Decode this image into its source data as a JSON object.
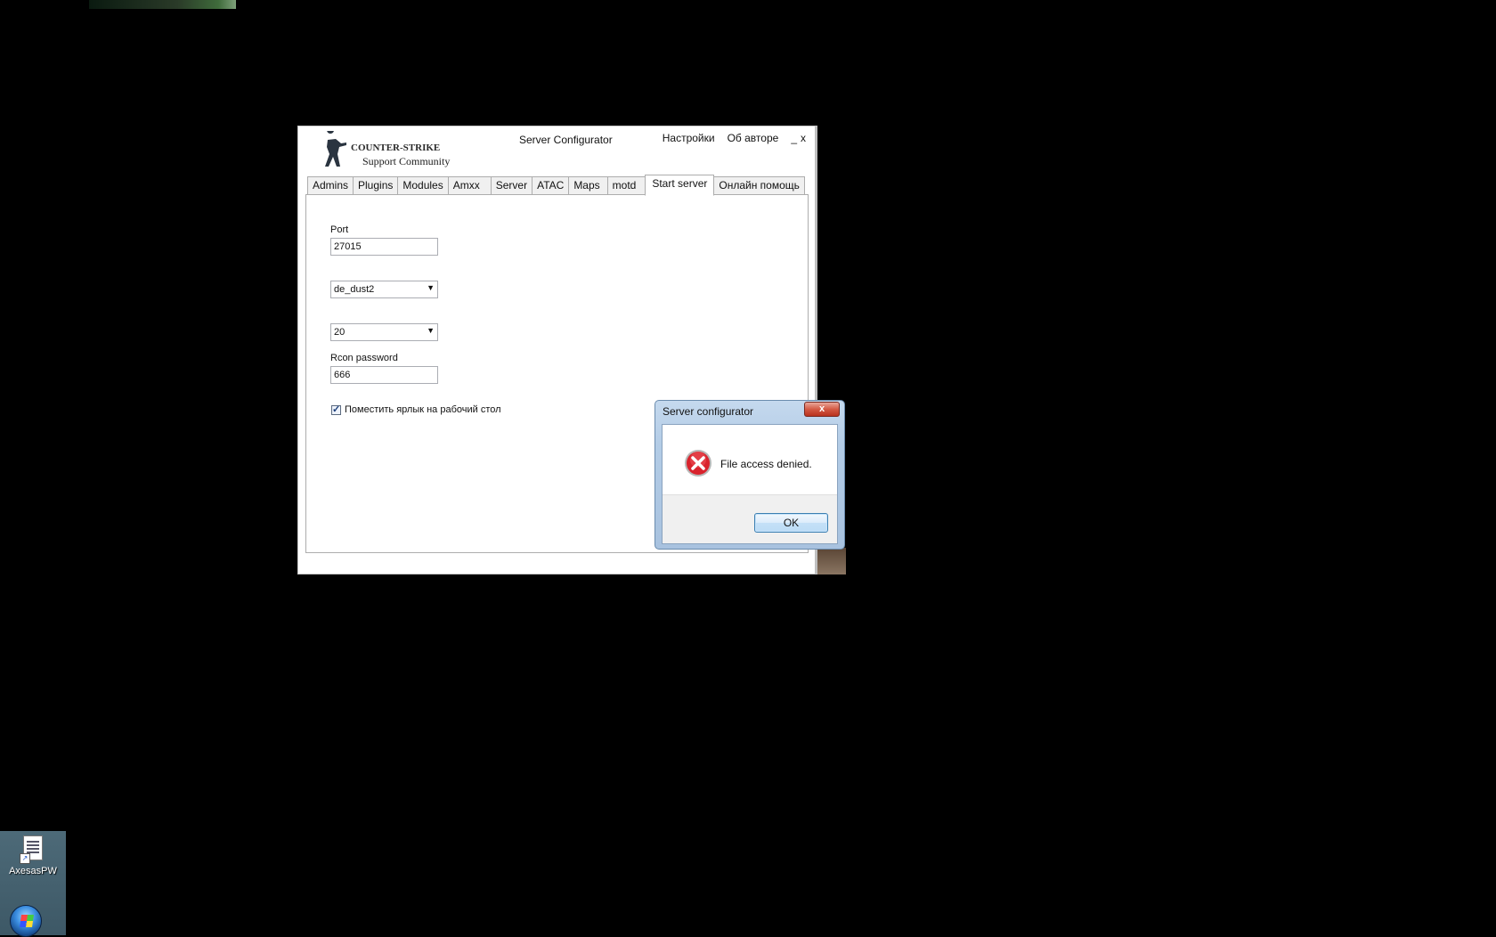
{
  "app": {
    "logo_line1": "COUNTER-STRIKE",
    "logo_line2": "Support Community",
    "title": "Server Configurator",
    "menu": {
      "settings": "Настройки",
      "about": "Об авторе",
      "minimize": "_",
      "close": "x"
    },
    "tabs": [
      {
        "label": "Admins"
      },
      {
        "label": "Plugins"
      },
      {
        "label": "Modules"
      },
      {
        "label": "Amxx"
      },
      {
        "label": "Server"
      },
      {
        "label": "ATAC"
      },
      {
        "label": "Maps"
      },
      {
        "label": "motd"
      },
      {
        "label": "Start server"
      },
      {
        "label": "Онлайн помощь"
      }
    ],
    "active_tab": "Start server",
    "start_server": {
      "port_label": "Port",
      "port_value": "27015",
      "map_value": "de_dust2",
      "players_value": "20",
      "rcon_label": "Rcon password",
      "rcon_value": "666",
      "shortcut_label": "Поместить ярлык на рабочий стол",
      "shortcut_checked": true
    }
  },
  "dialog": {
    "title": "Server configurator",
    "close_label": "x",
    "icon": "error-icon",
    "message": "File access denied.",
    "ok_label": "OK"
  },
  "desktop": {
    "icon_label": "AxesasPW"
  },
  "colors": {
    "background": "#000000",
    "error_red": "#d9232d",
    "dialog_frame": "#b3cce6",
    "close_button": "#d45a44"
  }
}
